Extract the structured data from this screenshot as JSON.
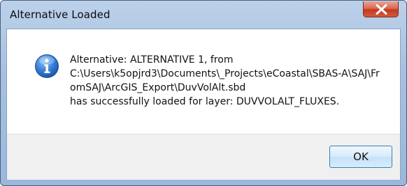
{
  "window": {
    "title": "Alternative Loaded"
  },
  "icons": {
    "close": "close-icon",
    "info": "info-icon"
  },
  "message": {
    "line1": "Alternative: ALTERNATIVE 1, from",
    "line2": "C:\\Users\\k5opjrd3\\Documents\\_Projects\\eCoastal\\SBAS-A\\SAJ\\Fr",
    "line3": "omSAJ\\ArcGIS_Export\\DuvVolAlt.sbd",
    "line4": "has successfully loaded for layer: DUVVOLALT_FLUXES."
  },
  "buttons": {
    "ok_label": "OK"
  },
  "colors": {
    "info_icon": "#2a6fc9",
    "close_button": "#c9452a"
  }
}
